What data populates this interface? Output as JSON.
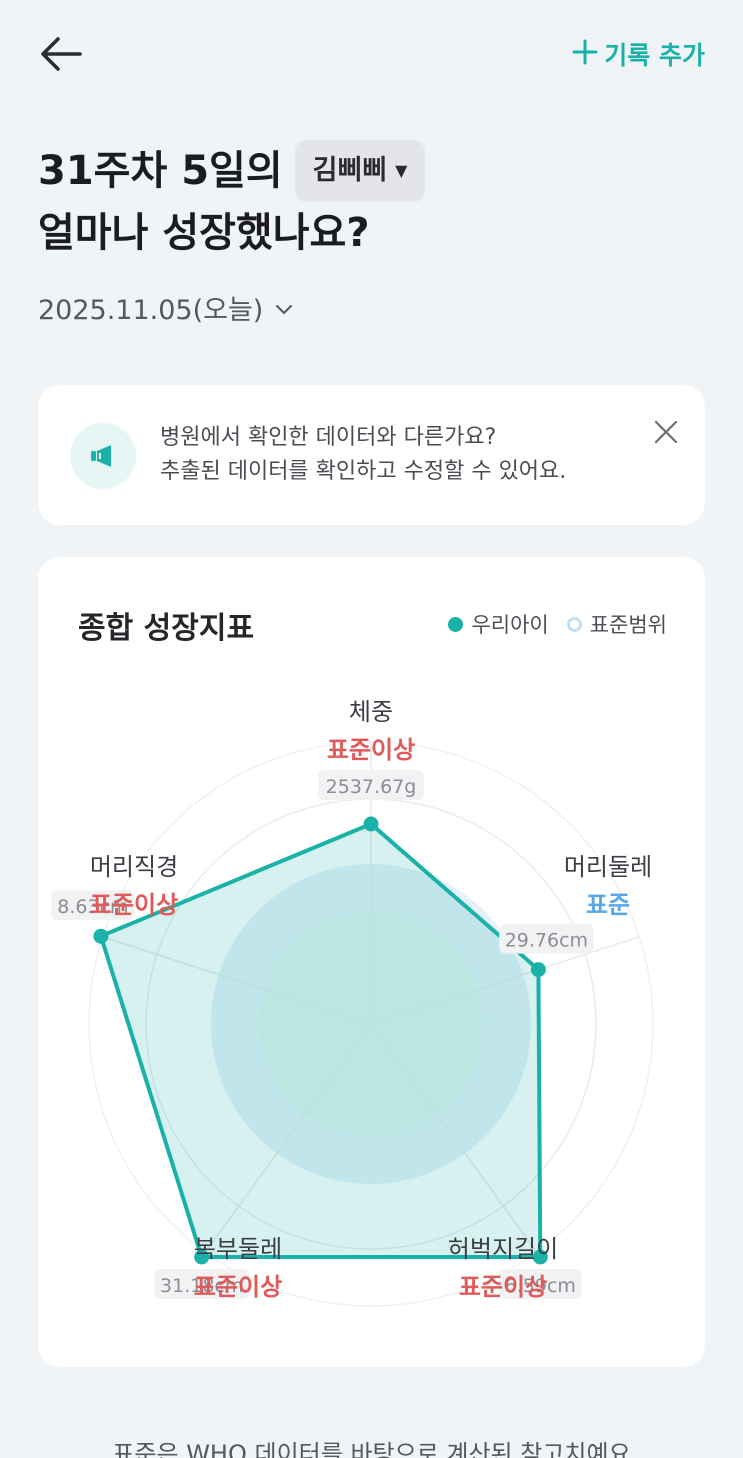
{
  "header": {
    "add_record_label": "기록 추가"
  },
  "headline": {
    "line1": "31주차 5일의",
    "baby_name": "김삐삐",
    "line2": "얼마나 성장했나요?"
  },
  "date": {
    "label": "2025.11.05(오늘)"
  },
  "notice": {
    "line1": "병원에서 확인한 데이터와 다른가요?",
    "line2": "추출된 데이터를 확인하고 수정할 수 있어요."
  },
  "card": {
    "title": "종합 성장지표",
    "legend_ours": "우리아이",
    "legend_standard": "표준범위"
  },
  "colors": {
    "accent": "#1ab2a8",
    "above_standard": "#e05a5a",
    "standard": "#5aa7e8"
  },
  "chart_data": {
    "type": "radar",
    "axes": [
      {
        "name": "체중",
        "status": "표준이상",
        "value_label": "2537.67g",
        "score": 0.5
      },
      {
        "name": "머리둘레",
        "status": "표준",
        "value_label": "29.76cm",
        "score": 0.44
      },
      {
        "name": "허벅지길이",
        "status": "표준이상",
        "value_label": "6.59cm",
        "score": 0.72
      },
      {
        "name": "복부둘레",
        "status": "표준이상",
        "value_label": "31.18cm",
        "score": 0.72
      },
      {
        "name": "머리직경",
        "status": "표준이상",
        "value_label": "8.63cm",
        "score": 0.71
      }
    ],
    "series": [
      {
        "name": "우리아이"
      },
      {
        "name": "표준범위"
      }
    ]
  },
  "footnote": "표준은 WHO 데이터를 바탕으로 계산된 참고치예요"
}
